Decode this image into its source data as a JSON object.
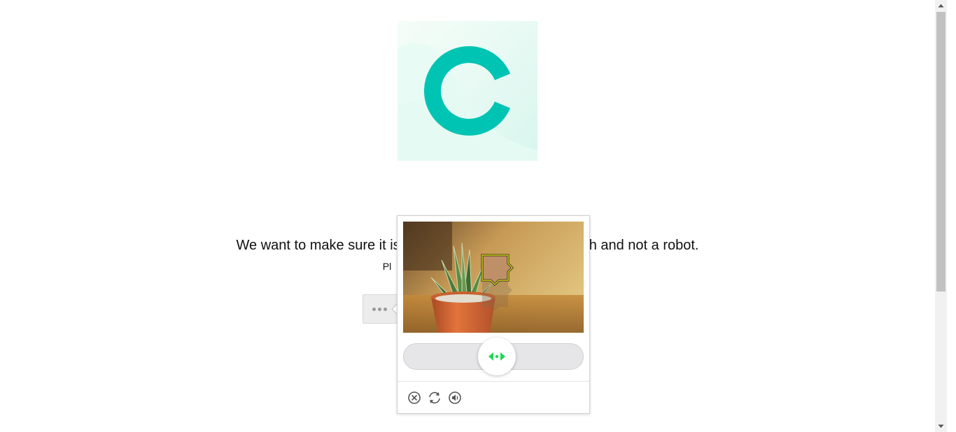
{
  "headline_left": "We want to make sure it is",
  "headline_right": "h and not a robot.",
  "subline_fragment": "Pl",
  "captcha": {
    "slider_progress": 0.48,
    "icons": [
      "close-icon",
      "refresh-icon",
      "audio-icon"
    ]
  },
  "colors": {
    "brand_teal": "#00c4b3",
    "slider_arrow_green": "#1fd655"
  }
}
